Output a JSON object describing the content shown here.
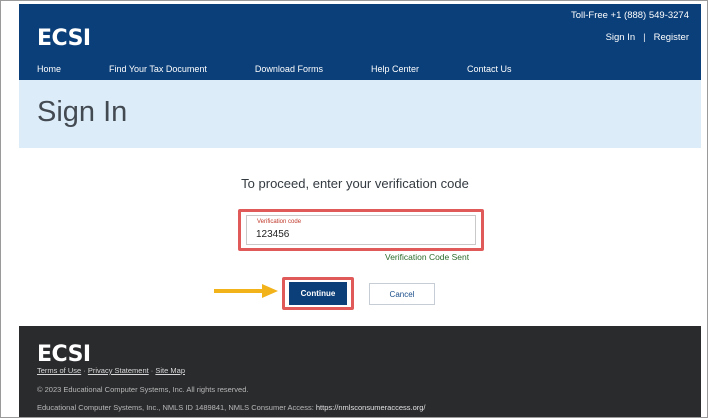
{
  "header": {
    "logo": "ECSI",
    "toll_free": "Toll-Free +1 (888) 549-3274",
    "sign_in": "Sign In",
    "separator": "|",
    "register": "Register",
    "nav": [
      "Home",
      "Find Your Tax Document",
      "Download Forms",
      "Help Center",
      "Contact Us"
    ]
  },
  "title_band": {
    "title": "Sign In"
  },
  "main": {
    "prompt": "To proceed, enter your verification code",
    "field_label": "Verification code",
    "field_value": "123456",
    "sent_message": "Verification Code Sent",
    "continue_label": "Continue",
    "cancel_label": "Cancel"
  },
  "footer": {
    "logo": "ECSI",
    "terms": "Terms of Use",
    "privacy": "Privacy Statement",
    "sitemap": "Site Map",
    "link_sep": " · ",
    "copyright": "© 2023 Educational Computer Systems, Inc. All rights reserved.",
    "nmls_text": "Educational Computer Systems, Inc., NMLS ID 1489841, NMLS Consumer Access: ",
    "nmls_link": "https://nmlsconsumeraccess.org/"
  },
  "colors": {
    "header_bg": "#0b3f79",
    "title_band_bg": "#dcedf9",
    "highlight": "#e05a5a",
    "arrow": "#f2b21a",
    "footer_bg": "#2a2b2d"
  }
}
